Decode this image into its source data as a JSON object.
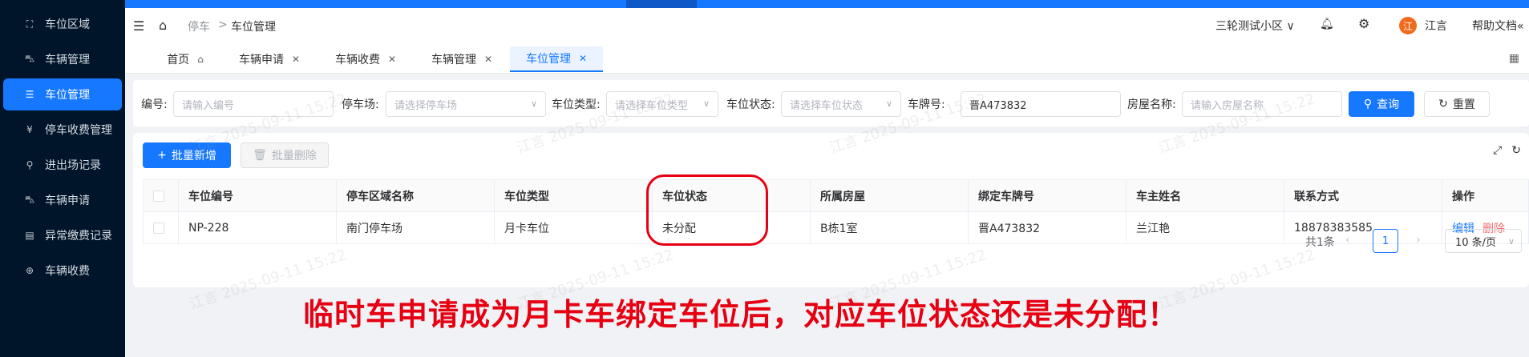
{
  "sidebar": {
    "items": [
      {
        "label": "车位区域",
        "icon": "area-icon"
      },
      {
        "label": "车辆管理",
        "icon": "car-icon"
      },
      {
        "label": "车位管理",
        "icon": "parking-icon",
        "active": true
      },
      {
        "label": "停车收费管理",
        "icon": "fee-icon"
      },
      {
        "label": "进出场记录",
        "icon": "record-icon"
      },
      {
        "label": "车辆申请",
        "icon": "apply-icon"
      },
      {
        "label": "异常缴费记录",
        "icon": "abnormal-icon"
      },
      {
        "label": "车辆收费",
        "icon": "charge-icon"
      }
    ]
  },
  "header": {
    "breadcrumb": [
      "停车",
      "车位管理"
    ],
    "breadcrumb_sep": ">",
    "community": "三轮测试小区",
    "user": "江言",
    "avatar_text": "江",
    "help": "帮助文档"
  },
  "tabs": [
    {
      "label": "首页"
    },
    {
      "label": "车辆申请"
    },
    {
      "label": "车辆收费"
    },
    {
      "label": "车辆管理"
    },
    {
      "label": "车位管理",
      "active": true
    }
  ],
  "search": {
    "code_label": "编号:",
    "code_placeholder": "请输入编号",
    "lot_label": "停车场:",
    "lot_placeholder": "请选择停车场",
    "type_label": "车位类型:",
    "type_placeholder": "请选择车位类型",
    "status_label": "车位状态:",
    "status_placeholder": "请选择车位状态",
    "plate_label": "车牌号:",
    "plate_value": "晋A473832",
    "house_label": "房屋名称:",
    "house_placeholder": "请输入房屋名称",
    "query_btn": "查询",
    "reset_btn": "重置"
  },
  "toolbar": {
    "batch_add": "批量新增",
    "batch_delete": "批量删除"
  },
  "table": {
    "columns": [
      "车位编号",
      "停车区域名称",
      "车位类型",
      "车位状态",
      "所属房屋",
      "绑定车牌号",
      "车主姓名",
      "联系方式",
      "操作"
    ],
    "rows": [
      {
        "code": "NP-228",
        "area": "南门停车场",
        "type": "月卡车位",
        "status": "未分配",
        "house": "B栋1室",
        "plate": "晋A473832",
        "owner": "兰江艳",
        "phone": "18878383585",
        "edit": "编辑",
        "delete": "删除"
      }
    ]
  },
  "pagination": {
    "total": "共1条",
    "current": "1",
    "page_size": "10 条/页"
  },
  "annotation": "临时车申请成为月卡车绑定车位后，对应车位状态还是未分配！",
  "watermark": "江言 2025-09-11 15:22",
  "colors": {
    "primary": "#1677ff",
    "sidebar": "#001529",
    "annotation": "#e60012",
    "delete": "#f56c6c"
  }
}
